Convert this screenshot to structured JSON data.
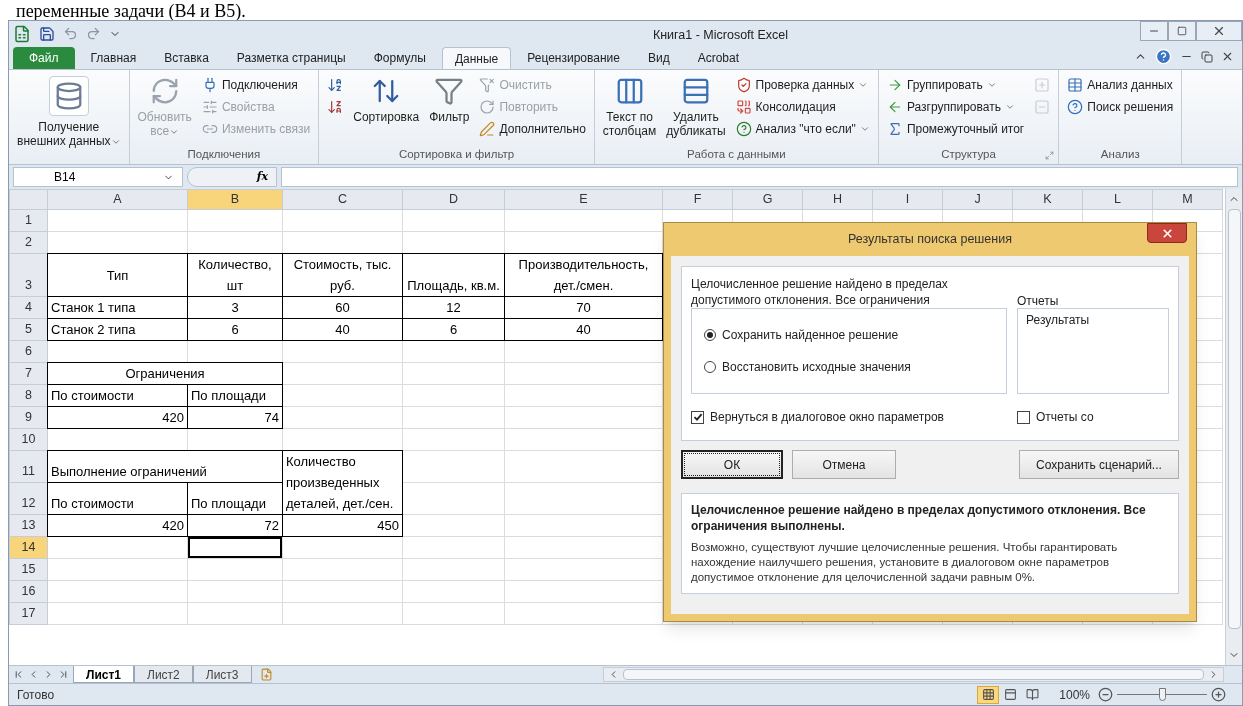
{
  "document_text": "переменные задачи (B4 и B5).",
  "window": {
    "title": "Книга1 - Microsoft Excel"
  },
  "tabs": [
    {
      "label": "Файл",
      "kind": "file",
      "selected": false
    },
    {
      "label": "Главная",
      "kind": "tab",
      "selected": false
    },
    {
      "label": "Вставка",
      "kind": "tab",
      "selected": false
    },
    {
      "label": "Разметка страницы",
      "kind": "tab",
      "selected": false
    },
    {
      "label": "Формулы",
      "kind": "tab",
      "selected": false
    },
    {
      "label": "Данные",
      "kind": "tab",
      "selected": true
    },
    {
      "label": "Рецензирование",
      "kind": "tab",
      "selected": false
    },
    {
      "label": "Вид",
      "kind": "tab",
      "selected": false
    },
    {
      "label": "Acrobat",
      "kind": "tab",
      "selected": false
    }
  ],
  "ribbon": {
    "groups": [
      {
        "items": [
          {
            "kind": "large",
            "label": "Получение\nвнешних данных",
            "disabled": false,
            "dropdown": true
          }
        ]
      },
      {
        "label": "Подключения",
        "items": [
          {
            "kind": "large",
            "label": "Обновить\nвсе",
            "disabled": true,
            "dropdown": true
          },
          {
            "kind": "small",
            "label": "Подключения",
            "disabled": false,
            "dropdown": false
          },
          {
            "kind": "small",
            "label": "Свойства",
            "disabled": true,
            "dropdown": false
          },
          {
            "kind": "small",
            "label": "Изменить связи",
            "disabled": true,
            "dropdown": false
          }
        ]
      },
      {
        "label": "Сортировка и фильтр",
        "items": [
          {
            "kind": "icon",
            "disabled": false
          },
          {
            "kind": "icon",
            "disabled": false
          },
          {
            "kind": "large",
            "label": "Сортировка",
            "disabled": false,
            "dropdown": false
          },
          {
            "kind": "large",
            "label": "Фильтр",
            "disabled": false,
            "dropdown": false
          },
          {
            "kind": "small",
            "label": "Очистить",
            "disabled": true,
            "dropdown": false
          },
          {
            "kind": "small",
            "label": "Повторить",
            "disabled": true,
            "dropdown": false
          },
          {
            "kind": "small",
            "label": "Дополнительно",
            "disabled": false,
            "dropdown": false
          }
        ]
      },
      {
        "label": "Работа с данными",
        "items": [
          {
            "kind": "large",
            "label": "Текст по\nстолбцам",
            "disabled": false,
            "dropdown": false
          },
          {
            "kind": "large",
            "label": "Удалить\nдубликаты",
            "disabled": false,
            "dropdown": false
          },
          {
            "kind": "small",
            "label": "Проверка данных",
            "disabled": false,
            "dropdown": true
          },
          {
            "kind": "small",
            "label": "Консолидация",
            "disabled": false,
            "dropdown": false
          },
          {
            "kind": "small",
            "label": "Анализ \"что если\"",
            "disabled": false,
            "dropdown": true
          }
        ]
      },
      {
        "label": "Структура",
        "launcher": true,
        "items": [
          {
            "kind": "small",
            "label": "Группировать",
            "disabled": false,
            "dropdown": true
          },
          {
            "kind": "small",
            "label": "Разгруппировать",
            "disabled": false,
            "dropdown": true
          },
          {
            "kind": "small",
            "label": "Промежуточный итог",
            "disabled": false,
            "dropdown": false
          },
          {
            "kind": "icon",
            "disabled": true
          },
          {
            "kind": "icon",
            "disabled": true
          }
        ]
      },
      {
        "label": "Анализ",
        "items": [
          {
            "kind": "small",
            "label": "Анализ данных",
            "disabled": false,
            "dropdown": false
          },
          {
            "kind": "small",
            "label": "Поиск решения",
            "disabled": false,
            "dropdown": false
          }
        ]
      }
    ]
  },
  "formula_bar": {
    "name_box": "B14",
    "function_label": "fx"
  },
  "sheet": {
    "columns": [
      {
        "label": "A",
        "selected": false
      },
      {
        "label": "B",
        "selected": true
      },
      {
        "label": "C",
        "selected": false
      },
      {
        "label": "D",
        "selected": false
      },
      {
        "label": "E",
        "selected": false
      },
      {
        "label": "F",
        "selected": false
      },
      {
        "label": "G",
        "selected": false
      },
      {
        "label": "H",
        "selected": false
      },
      {
        "label": "I",
        "selected": false
      },
      {
        "label": "J",
        "selected": false
      },
      {
        "label": "K",
        "selected": false
      },
      {
        "label": "L",
        "selected": false
      },
      {
        "label": "M",
        "selected": false
      }
    ],
    "rows": [
      {
        "number": "1",
        "selected": false
      },
      {
        "number": "2",
        "selected": false
      },
      {
        "number": "3",
        "selected": false,
        "cells": [
          {
            "text": "Тип",
            "kind": "caption",
            "boxed": true
          },
          {
            "text": "Количество, шт",
            "kind": "header",
            "boxed": true
          },
          {
            "text": "Стоимость, тыс. руб.",
            "kind": "header",
            "boxed": true
          },
          {
            "text": "Площадь, кв.м.",
            "kind": "header",
            "boxed": true
          },
          {
            "text": "Производительность, дет./смен.",
            "kind": "header",
            "boxed": true
          }
        ]
      },
      {
        "number": "4",
        "selected": false,
        "cells": [
          {
            "text": "Станок 1 типа",
            "kind": "label",
            "boxed": true
          },
          {
            "text": "3",
            "kind": "value",
            "boxed": true
          },
          {
            "text": "60",
            "kind": "value",
            "boxed": true
          },
          {
            "text": "12",
            "kind": "value",
            "boxed": true
          },
          {
            "text": "70",
            "kind": "value",
            "boxed": true
          }
        ]
      },
      {
        "number": "5",
        "selected": false,
        "cells": [
          {
            "text": "Станок 2 типа",
            "kind": "label",
            "boxed": true
          },
          {
            "text": "6",
            "kind": "value",
            "boxed": true
          },
          {
            "text": "40",
            "kind": "value",
            "boxed": true
          },
          {
            "text": "6",
            "kind": "value",
            "boxed": true
          },
          {
            "text": "40",
            "kind": "value",
            "boxed": true
          }
        ]
      },
      {
        "number": "6",
        "selected": false
      },
      {
        "number": "7",
        "selected": false,
        "cells": [
          {
            "text": "Ограничения",
            "kind": "header",
            "boxed": true,
            "spans_right": true
          }
        ]
      },
      {
        "number": "8",
        "selected": false,
        "cells": [
          {
            "text": "По стоимости",
            "kind": "label",
            "boxed": true
          },
          {
            "text": "По площади",
            "kind": "label",
            "boxed": true
          }
        ]
      },
      {
        "number": "9",
        "selected": false,
        "cells": [
          {
            "text": "420",
            "kind": "number",
            "boxed": true
          },
          {
            "text": "74",
            "kind": "number",
            "boxed": true
          }
        ]
      },
      {
        "number": "10",
        "selected": false
      },
      {
        "number": "11",
        "selected": false,
        "cells": [
          {
            "text": "Выполнение ограничений",
            "kind": "label",
            "boxed": true,
            "spans_right": true
          },
          {
            "text": "Количество произведенных деталей, дет./сен.",
            "kind": "note",
            "boxed": true,
            "spans_down": true
          }
        ]
      },
      {
        "number": "12",
        "selected": false,
        "cells": [
          {
            "text": "По стоимости",
            "kind": "label",
            "boxed": true
          },
          {
            "text": "По площади",
            "kind": "label",
            "boxed": true
          }
        ]
      },
      {
        "number": "13",
        "selected": false,
        "cells": [
          {
            "text": "420",
            "kind": "number",
            "boxed": true
          },
          {
            "text": "72",
            "kind": "number",
            "boxed": true
          },
          {
            "text": "450",
            "kind": "number",
            "boxed": true
          }
        ]
      },
      {
        "number": "14",
        "selected": true,
        "cells": [
          {
            "boxed": false
          },
          {
            "boxed": false,
            "selected": true
          }
        ]
      },
      {
        "number": "15",
        "selected": false
      },
      {
        "number": "16",
        "selected": false
      },
      {
        "number": "17",
        "selected": false
      }
    ]
  },
  "sheet_tabs": [
    {
      "label": "Лист1",
      "selected": true
    },
    {
      "label": "Лист2",
      "selected": false
    },
    {
      "label": "Лист3",
      "selected": false
    }
  ],
  "status_bar": {
    "status": "Готово",
    "views": [
      {
        "selected": true
      },
      {
        "selected": false
      },
      {
        "selected": false
      }
    ],
    "zoom": "100%",
    "zoom_slider": {
      "level": 0.5
    }
  },
  "dialog": {
    "title": "Результаты поиска решения",
    "message": "Целочисленное решение найдено в пределах допустимого отклонения. Все ограничения",
    "options": [
      {
        "label": "Сохранить найденное решение",
        "selected": true
      },
      {
        "label": "Восстановить исходные значения",
        "selected": false
      }
    ],
    "reports_label": "Отчеты",
    "reports": [
      {
        "label": "Результаты",
        "selected": false
      }
    ],
    "checkboxes": [
      {
        "label": "Вернуться в диалоговое окно параметров",
        "checked": true
      },
      {
        "label": "Отчеты со",
        "checked": false
      }
    ],
    "buttons": [
      {
        "label": "ОК",
        "kind": "default"
      },
      {
        "label": "Отмена",
        "kind": "normal"
      },
      {
        "label": "Сохранить сценарий...",
        "kind": "wide"
      }
    ],
    "info_title": "Целочисленное решение найдено в пределах допустимого отклонения. Все ограничения выполнены.",
    "info_text": "Возможно, существуют лучшие целочисленные решения. Чтобы гарантировать нахождение наилучшего решения, установите в диалоговом окне параметров допустимое отклонение для целочисленной задачи равным 0%."
  }
}
